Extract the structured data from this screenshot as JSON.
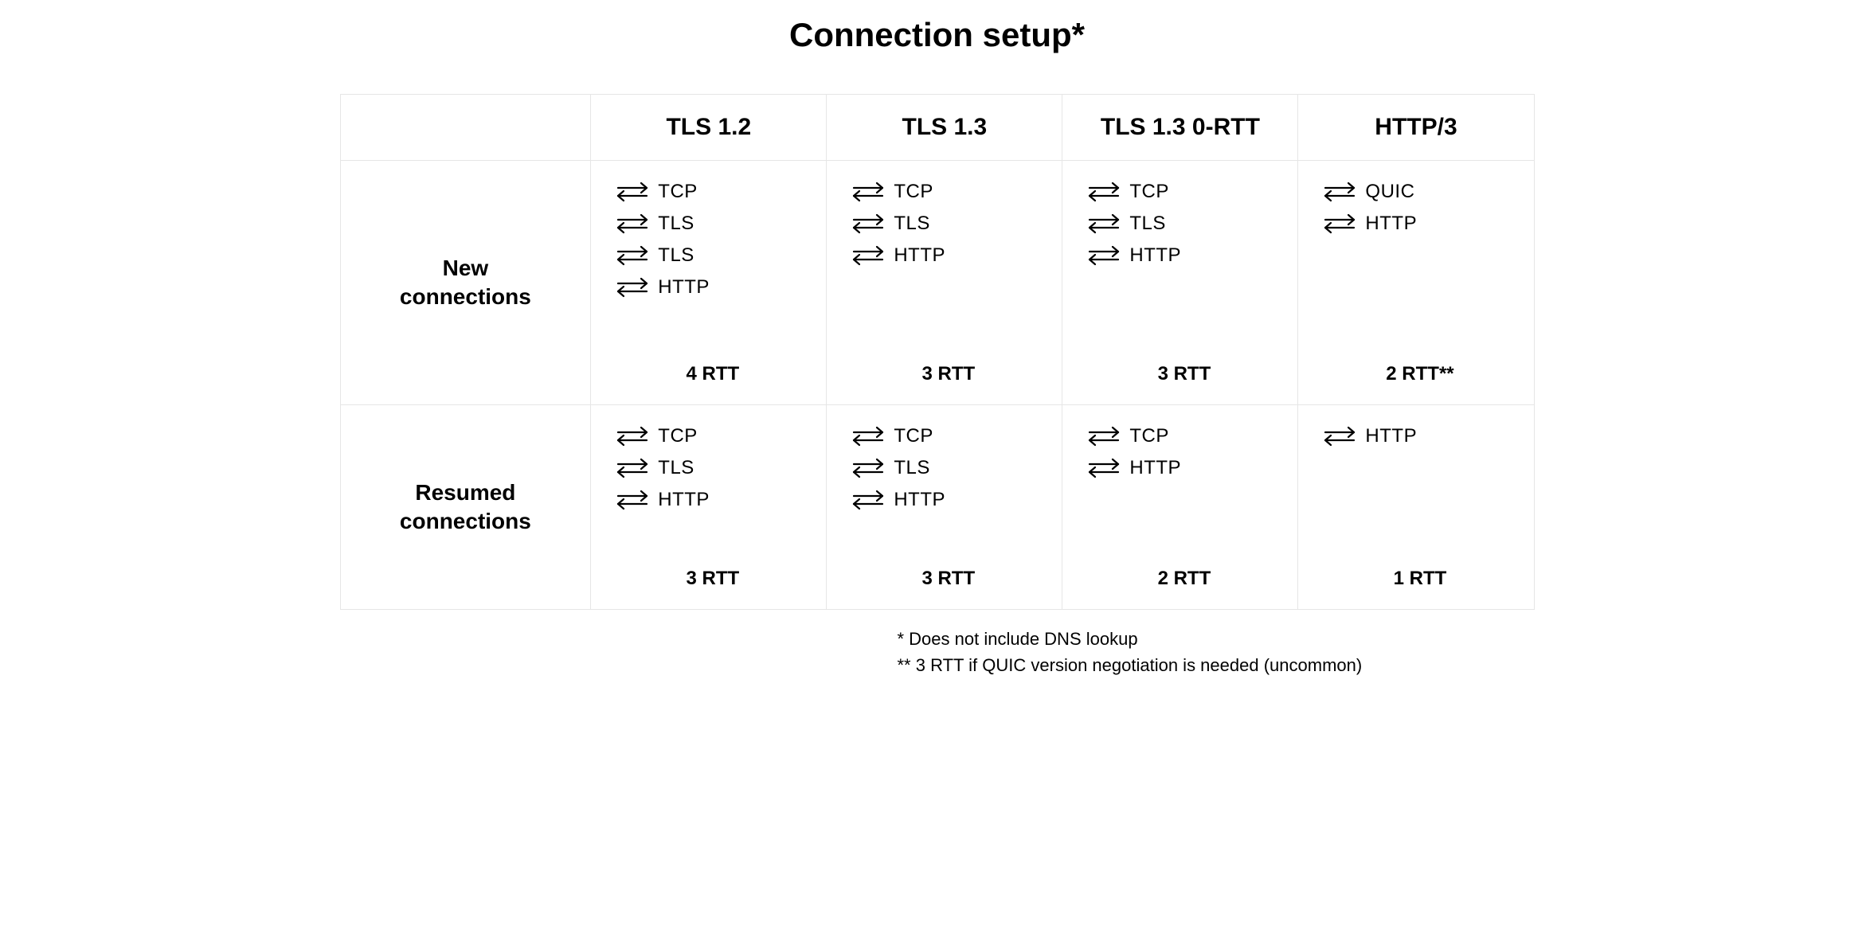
{
  "title": "Connection setup*",
  "columns": [
    "TLS 1.2",
    "TLS 1.3",
    "TLS 1.3 0-RTT",
    "HTTP/3"
  ],
  "rows": [
    {
      "label": "New\nconnections",
      "cells": [
        {
          "steps": [
            "TCP",
            "TLS",
            "TLS",
            "HTTP"
          ],
          "rtt": "4 RTT"
        },
        {
          "steps": [
            "TCP",
            "TLS",
            "HTTP"
          ],
          "rtt": "3 RTT"
        },
        {
          "steps": [
            "TCP",
            "TLS",
            "HTTP"
          ],
          "rtt": "3 RTT"
        },
        {
          "steps": [
            "QUIC",
            "HTTP"
          ],
          "rtt": "2 RTT**"
        }
      ]
    },
    {
      "label": "Resumed\nconnections",
      "cells": [
        {
          "steps": [
            "TCP",
            "TLS",
            "HTTP"
          ],
          "rtt": "3 RTT"
        },
        {
          "steps": [
            "TCP",
            "TLS",
            "HTTP"
          ],
          "rtt": "3 RTT"
        },
        {
          "steps": [
            "TCP",
            "HTTP"
          ],
          "rtt": "2 RTT"
        },
        {
          "steps": [
            "HTTP"
          ],
          "rtt": "1 RTT"
        }
      ]
    }
  ],
  "footnotes": [
    "* Does not include DNS lookup",
    "** 3 RTT if QUIC version negotiation is needed (uncommon)"
  ],
  "chart_data": {
    "type": "table",
    "title": "Connection setup*",
    "x_categories": [
      "TLS 1.2",
      "TLS 1.3",
      "TLS 1.3 0-RTT",
      "HTTP/3"
    ],
    "y_categories": [
      "New connections",
      "Resumed connections"
    ],
    "cells": [
      [
        {
          "round_trips": [
            "TCP",
            "TLS",
            "TLS",
            "HTTP"
          ],
          "rtt_count": 4,
          "rtt_label": "4 RTT"
        },
        {
          "round_trips": [
            "TCP",
            "TLS",
            "HTTP"
          ],
          "rtt_count": 3,
          "rtt_label": "3 RTT"
        },
        {
          "round_trips": [
            "TCP",
            "TLS",
            "HTTP"
          ],
          "rtt_count": 3,
          "rtt_label": "3 RTT"
        },
        {
          "round_trips": [
            "QUIC",
            "HTTP"
          ],
          "rtt_count": 2,
          "rtt_label": "2 RTT**"
        }
      ],
      [
        {
          "round_trips": [
            "TCP",
            "TLS",
            "HTTP"
          ],
          "rtt_count": 3,
          "rtt_label": "3 RTT"
        },
        {
          "round_trips": [
            "TCP",
            "TLS",
            "HTTP"
          ],
          "rtt_count": 3,
          "rtt_label": "3 RTT"
        },
        {
          "round_trips": [
            "TCP",
            "HTTP"
          ],
          "rtt_count": 2,
          "rtt_label": "2 RTT"
        },
        {
          "round_trips": [
            "HTTP"
          ],
          "rtt_count": 1,
          "rtt_label": "1 RTT"
        }
      ]
    ],
    "footnotes": [
      "* Does not include DNS lookup",
      "** 3 RTT if QUIC version negotiation is needed (uncommon)"
    ]
  }
}
